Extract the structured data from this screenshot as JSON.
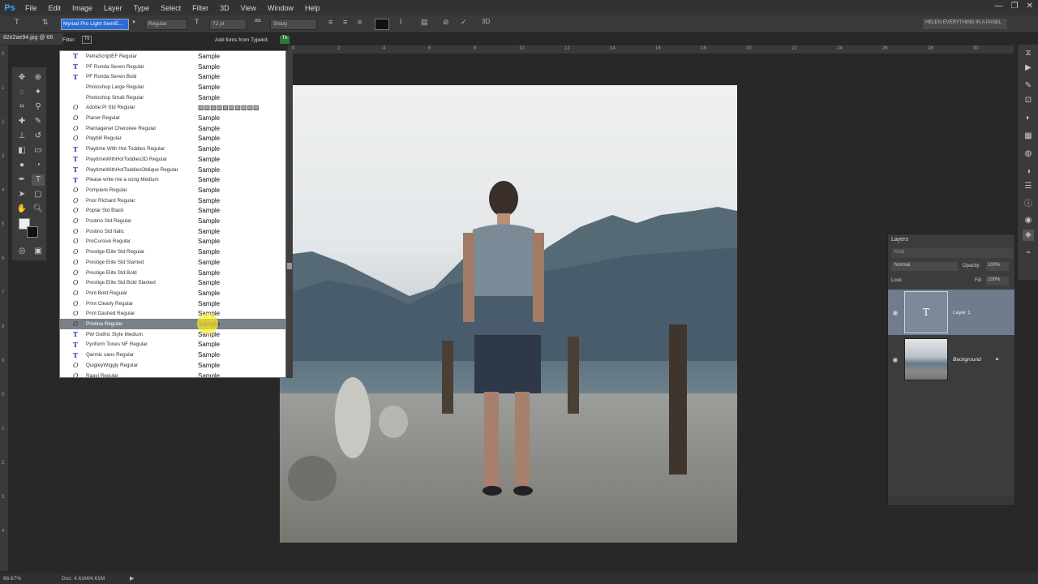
{
  "app": {
    "logo": "Ps"
  },
  "menu": [
    "File",
    "Edit",
    "Image",
    "Layer",
    "Type",
    "Select",
    "Filter",
    "3D",
    "View",
    "Window",
    "Help"
  ],
  "window_controls": [
    "—",
    "❐",
    "✕"
  ],
  "options_bar": {
    "font_family": "Myriad Pro Light SemiE...",
    "font_style": "Regular",
    "font_size": "72 pt",
    "antialias": "Sharp",
    "workspace": "HELEN EVERYTHING IN A PANEL",
    "three_d": "3D"
  },
  "document_tab": "82e2ae94.jpg @ 66",
  "font_filter": {
    "filter_label": "Filter:",
    "typekit_label": "Add fonts from Typekit:"
  },
  "font_list": [
    {
      "icon": "T",
      "name": "PetraScriptEF Regular",
      "sample": "Sample",
      "selected": false
    },
    {
      "icon": "T",
      "name": "PF Ronda Seven Regular",
      "sample": "Sample",
      "selected": false
    },
    {
      "icon": "T",
      "name": "PF Ronda Seven Bold",
      "sample": "Sample",
      "selected": false
    },
    {
      "icon": "",
      "name": "Photoshop Large Regular",
      "sample": "Sample",
      "selected": false
    },
    {
      "icon": "",
      "name": "Photoshop Small Regular",
      "sample": "Sample",
      "selected": false
    },
    {
      "icon": "O",
      "name": "Adobe Pi Std Regular",
      "sample": "▧▧▧▧▧▧▧▧▧▧",
      "selected": false
    },
    {
      "icon": "O",
      "name": "Planer Regular",
      "sample": "Sample",
      "selected": false
    },
    {
      "icon": "O",
      "name": "Plantagenet Cherokee Regular",
      "sample": "Sample",
      "selected": false
    },
    {
      "icon": "O",
      "name": "Playbill Regular",
      "sample": "Sample",
      "selected": false
    },
    {
      "icon": "T",
      "name": "Playtime With Hot Toddies Regular",
      "sample": "Sample",
      "selected": false
    },
    {
      "icon": "T",
      "name": "PlaytimeWithHotToddies3D Regular",
      "sample": "Sample",
      "selected": false
    },
    {
      "icon": "T",
      "name": "PlaytimeWithHotToddiesOblique Regular",
      "sample": "Sample",
      "selected": false
    },
    {
      "icon": "T",
      "name": "Please write me a song Medium",
      "sample": "Sample",
      "selected": false
    },
    {
      "icon": "O",
      "name": "Pompiere  Regular",
      "sample": "Sample",
      "selected": false
    },
    {
      "icon": "O",
      "name": "Poor Richard Regular",
      "sample": "Sample",
      "selected": false
    },
    {
      "icon": "O",
      "name": "Poplar Std Black",
      "sample": "Sample",
      "selected": false
    },
    {
      "icon": "O",
      "name": "Postino Std Regular",
      "sample": "Sample",
      "selected": false
    },
    {
      "icon": "O",
      "name": "Postino Std Italic",
      "sample": "Sample",
      "selected": false
    },
    {
      "icon": "O",
      "name": "PreCursive Regular",
      "sample": "Sample",
      "selected": false
    },
    {
      "icon": "O",
      "name": "Prestige Elite Std Regular",
      "sample": "Sample",
      "selected": false
    },
    {
      "icon": "O",
      "name": "Prestige Elite Std Slanted",
      "sample": "Sample",
      "selected": false
    },
    {
      "icon": "O",
      "name": "Prestige Elite Std Bold",
      "sample": "Sample",
      "selected": false
    },
    {
      "icon": "O",
      "name": "Prestige Elite Std Bold Slanted",
      "sample": "Sample",
      "selected": false
    },
    {
      "icon": "O",
      "name": "Print Bold Regular",
      "sample": "Sample",
      "selected": false
    },
    {
      "icon": "O",
      "name": "Print Clearly Regular",
      "sample": "Sample",
      "selected": false
    },
    {
      "icon": "O",
      "name": "Print Dashed Regular",
      "sample": "Sample",
      "selected": false
    },
    {
      "icon": "O",
      "name": "Pristina Regular",
      "sample": "Sample",
      "selected": true
    },
    {
      "icon": "T",
      "name": "PW Gothic Style Medium",
      "sample": "Sample",
      "selected": false
    },
    {
      "icon": "T",
      "name": "Pyriform Tones NF Regular",
      "sample": "Sample",
      "selected": false
    },
    {
      "icon": "T",
      "name": "Qarmic sans Regular",
      "sample": "Sample",
      "selected": false
    },
    {
      "icon": "O",
      "name": "QuigleyWiggly Regular",
      "sample": "Sample",
      "selected": false
    },
    {
      "icon": "O",
      "name": "Raavi Regular",
      "sample": "Sample",
      "selected": false
    }
  ],
  "layers_panel": {
    "title": "Layers",
    "kind": "Kind",
    "blend_mode": "Normal",
    "opacity_label": "Opacity:",
    "opacity": "100%",
    "lock_label": "Lock:",
    "fill_label": "Fill:",
    "fill": "100%",
    "layers": [
      {
        "name": "Layer 1",
        "type": "text",
        "active": true
      },
      {
        "name": "Background",
        "type": "image",
        "active": false
      }
    ]
  },
  "status": {
    "zoom": "66.67%",
    "doc": "Doc: 4.61M/4.61M"
  },
  "ruler_top_ticks": [
    "0",
    "2",
    "4",
    "6",
    "8",
    "10",
    "12",
    "14",
    "16",
    "18",
    "20",
    "22",
    "24",
    "26",
    "28",
    "30"
  ],
  "ruler_left_ticks": [
    "0",
    "1",
    "2",
    "3",
    "4",
    "5",
    "6",
    "7",
    "8",
    "9",
    "0",
    "1",
    "2",
    "3",
    "4"
  ],
  "colors": {
    "accent": "#2a6bd6",
    "selected_row": "#7a8088",
    "active_layer": "#707b8c",
    "cursor_highlight": "#fff028"
  }
}
